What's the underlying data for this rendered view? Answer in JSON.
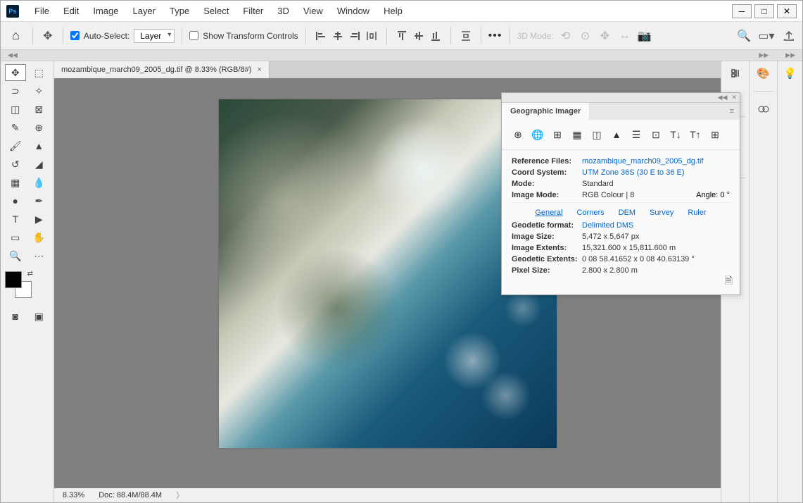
{
  "menu": [
    "File",
    "Edit",
    "Image",
    "Layer",
    "Type",
    "Select",
    "Filter",
    "3D",
    "View",
    "Window",
    "Help"
  ],
  "options": {
    "auto_select_label": "Auto-Select:",
    "layer_select": "Layer",
    "show_transform": "Show Transform Controls",
    "mode_3d": "3D Mode:"
  },
  "doc_tab": "mozambique_march09_2005_dg.tif @ 8.33% (RGB/8#)",
  "status": {
    "zoom": "8.33%",
    "doc": "Doc: 88.4M/88.4M"
  },
  "geo": {
    "title": "Geographic Imager",
    "ref_files_label": "Reference Files:",
    "ref_files": "mozambique_march09_2005_dg.tif",
    "coord_label": "Coord System:",
    "coord": "UTM Zone 36S (30 E to 36 E)",
    "mode_label": "Mode:",
    "mode": "Standard",
    "img_mode_label": "Image Mode:",
    "img_mode": "RGB Colour | 8",
    "angle_label": "Angle:",
    "angle": "0 °",
    "tabs": [
      "General",
      "Corners",
      "DEM",
      "Survey",
      "Ruler"
    ],
    "geodetic_format_label": "Geodetic format:",
    "geodetic_format": "Delimited DMS",
    "image_size_label": "Image Size:",
    "image_size": "5,472 x 5,647 px",
    "image_extents_label": "Image Extents:",
    "image_extents": "15,321.600 x 15,811.600 m",
    "geodetic_extents_label": "Geodetic Extents:",
    "geodetic_extents": "0 08 58.41652 x 0 08 40.63139 °",
    "pixel_size_label": "Pixel Size:",
    "pixel_size": "2.800 x 2.800 m"
  }
}
